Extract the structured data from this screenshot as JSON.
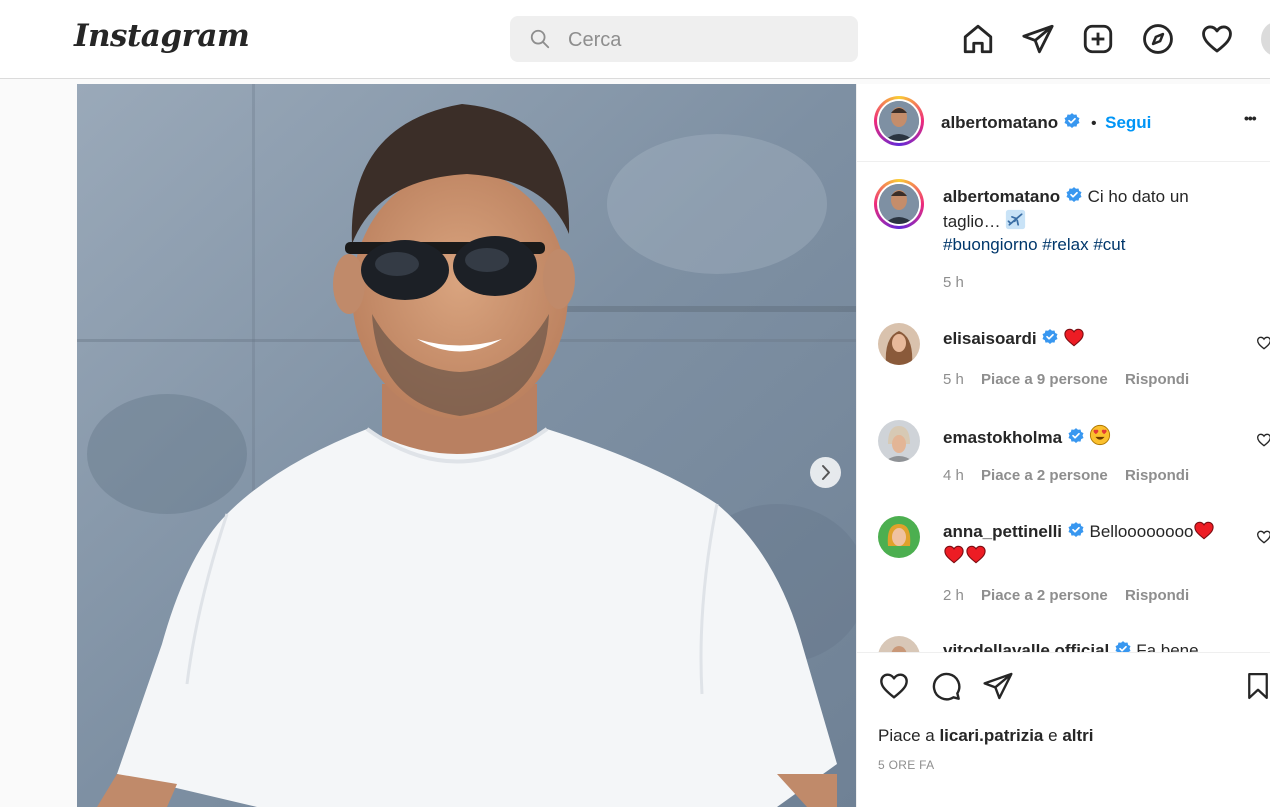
{
  "header": {
    "logo": "Instagram",
    "search": {
      "placeholder": "Cerca"
    }
  },
  "nav_icons": [
    "home-icon",
    "direct-message-icon",
    "new-post-icon",
    "explore-icon",
    "activity-heart-icon",
    "profile-avatar"
  ],
  "post": {
    "author": "albertomatano",
    "follow_label": "Segui",
    "dot_separator": "•",
    "more_label": "•••",
    "caption": {
      "username": "albertomatano",
      "text_line1": "Ci ho dato un",
      "text_line2": "taglio…",
      "hashtags": [
        "#buongiorno",
        "#relax",
        "#cut"
      ],
      "time": "5 h"
    },
    "comments": [
      {
        "username": "elisaisoardi",
        "text": "",
        "time": "5 h",
        "likes": "Piace a 9 persone",
        "reply": "Rispondi"
      },
      {
        "username": "emastokholma",
        "text": "",
        "time": "4 h",
        "likes": "Piace a 2 persone",
        "reply": "Rispondi"
      },
      {
        "username": "anna_pettinelli",
        "text": "Belloooooooo",
        "time": "2 h",
        "likes": "Piace a 2 persone",
        "reply": "Rispondi"
      },
      {
        "username": "vitodellavalle.official",
        "text": "Fa bene"
      }
    ],
    "likes": {
      "prefix": "Piace a",
      "user": "licari.patrizia",
      "and": "e",
      "others": "altri"
    },
    "timestamp": "5 ORE FA"
  },
  "colors": {
    "accent_blue": "#0095f6",
    "hashtag_blue": "#00376b",
    "verified_blue": "#3897f0",
    "heart_red": "#ed1c24",
    "muted_text": "#8e8e8e"
  }
}
